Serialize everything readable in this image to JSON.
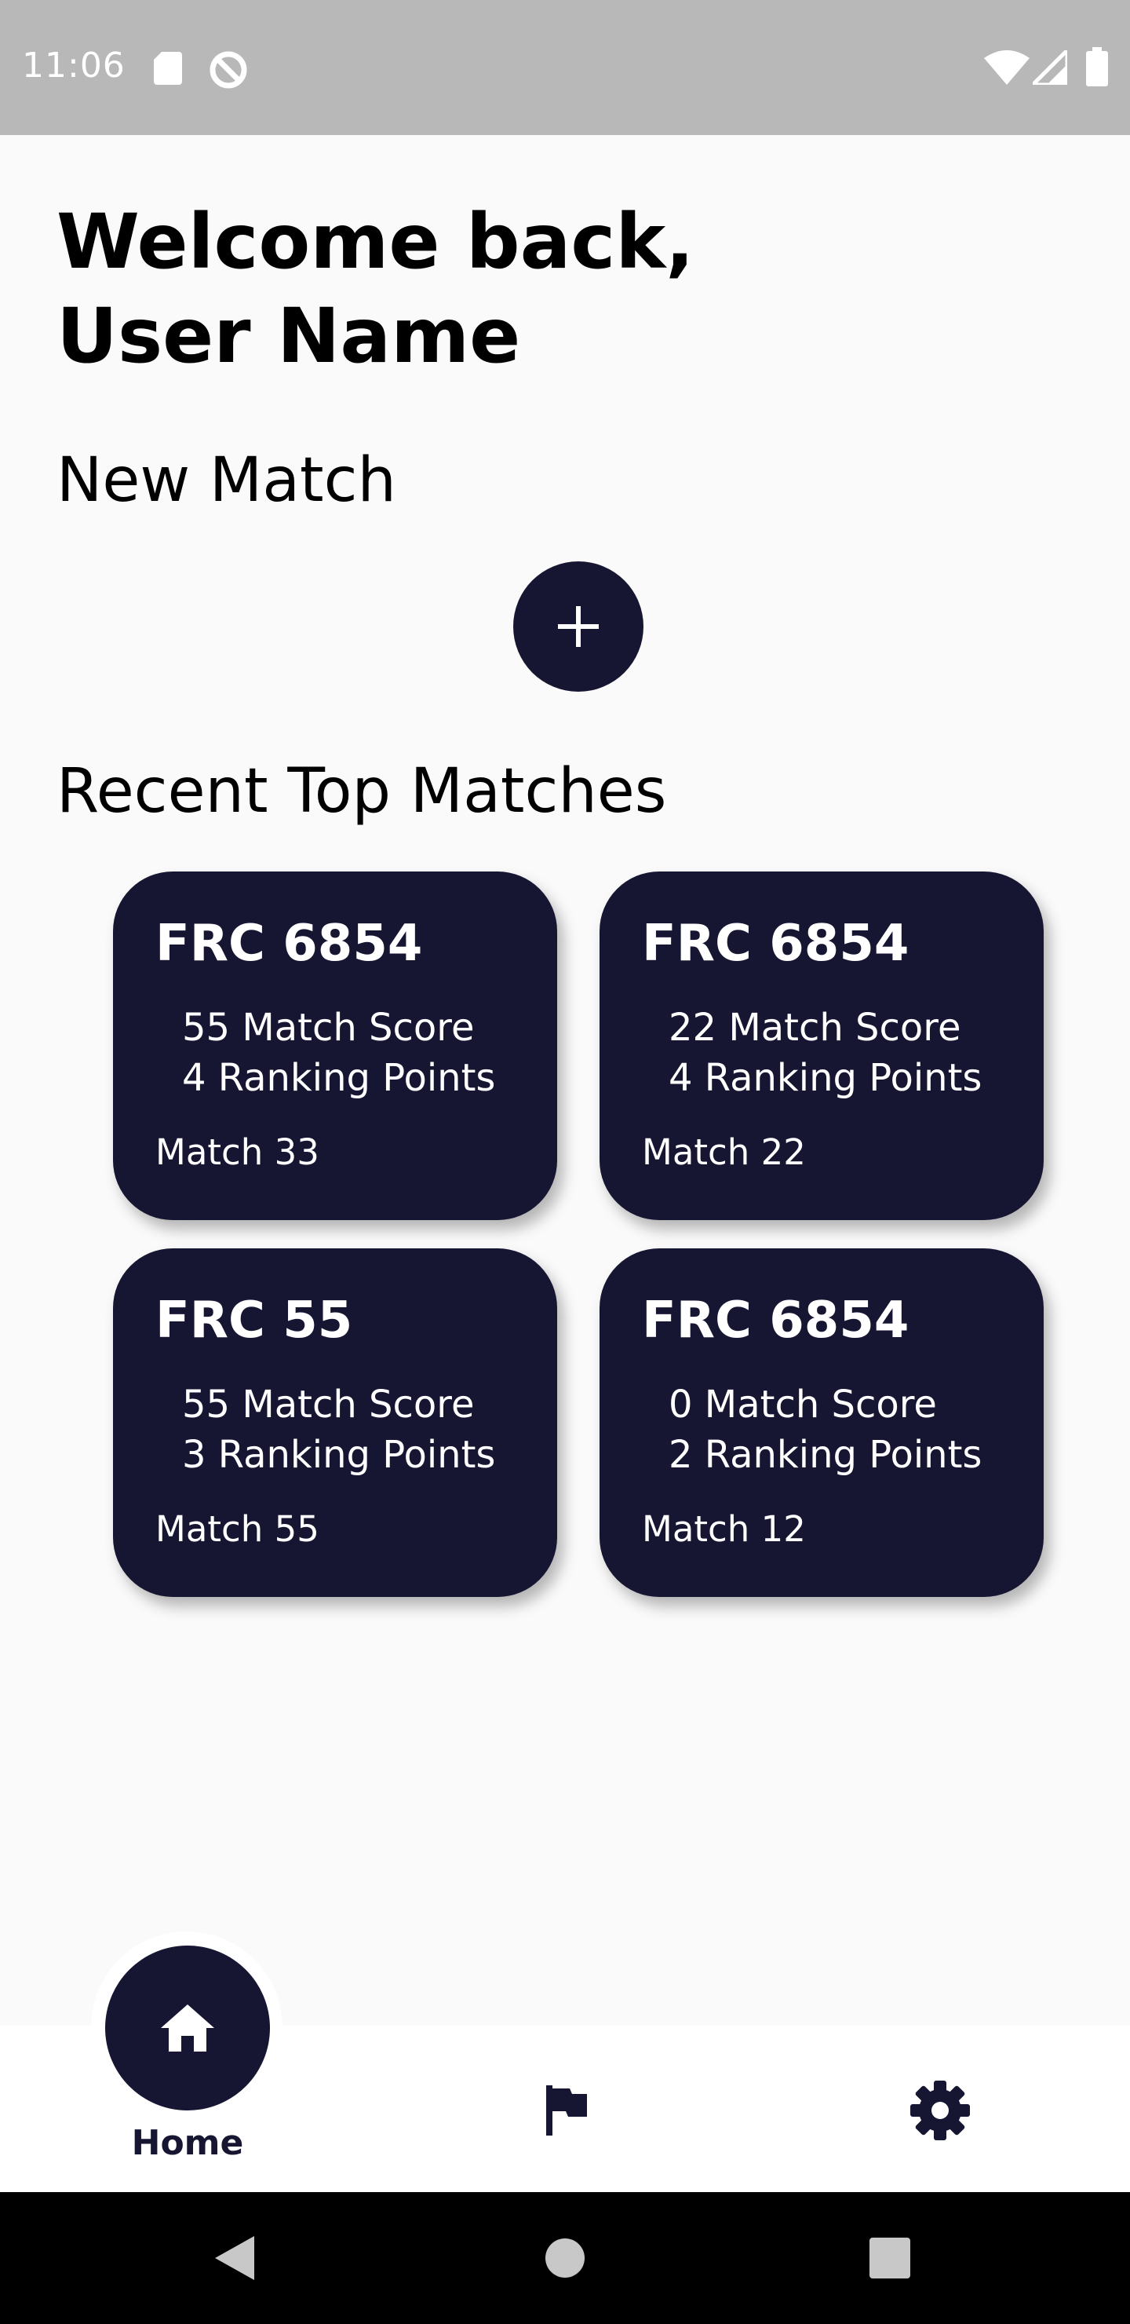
{
  "status_bar": {
    "time": "11:06",
    "icons": [
      "sd-card-icon",
      "sync-disabled-icon",
      "wifi-icon",
      "signal-icon",
      "battery-icon"
    ]
  },
  "greeting": {
    "line1": "Welcome back,",
    "line2": "User Name"
  },
  "new_match": {
    "title": "New Match",
    "button_icon": "plus-icon"
  },
  "recent": {
    "title": "Recent Top Matches",
    "cards": [
      {
        "team": "FRC 6854",
        "score": "55 Match Score",
        "ranking": "4 Ranking Points",
        "match": "Match 33"
      },
      {
        "team": "FRC 6854",
        "score": "22 Match Score",
        "ranking": "4 Ranking Points",
        "match": "Match 22"
      },
      {
        "team": "FRC 55",
        "score": "55 Match Score",
        "ranking": "3 Ranking Points",
        "match": "Match 55"
      },
      {
        "team": "FRC 6854",
        "score": "0 Match Score",
        "ranking": "2 Ranking Points",
        "match": "Match 12"
      }
    ]
  },
  "bottom_nav": {
    "items": [
      {
        "label": "Home",
        "icon": "home-icon",
        "active": true
      },
      {
        "label": "",
        "icon": "flag-icon",
        "active": false
      },
      {
        "label": "",
        "icon": "gear-icon",
        "active": false
      }
    ]
  },
  "system_nav": {
    "icons": [
      "back-icon",
      "home-circle-icon",
      "recents-icon"
    ]
  },
  "colors": {
    "primary": "#161633",
    "background": "#fafafa",
    "status_bar": "#b8b8b8",
    "nav_background": "#ffffff"
  }
}
